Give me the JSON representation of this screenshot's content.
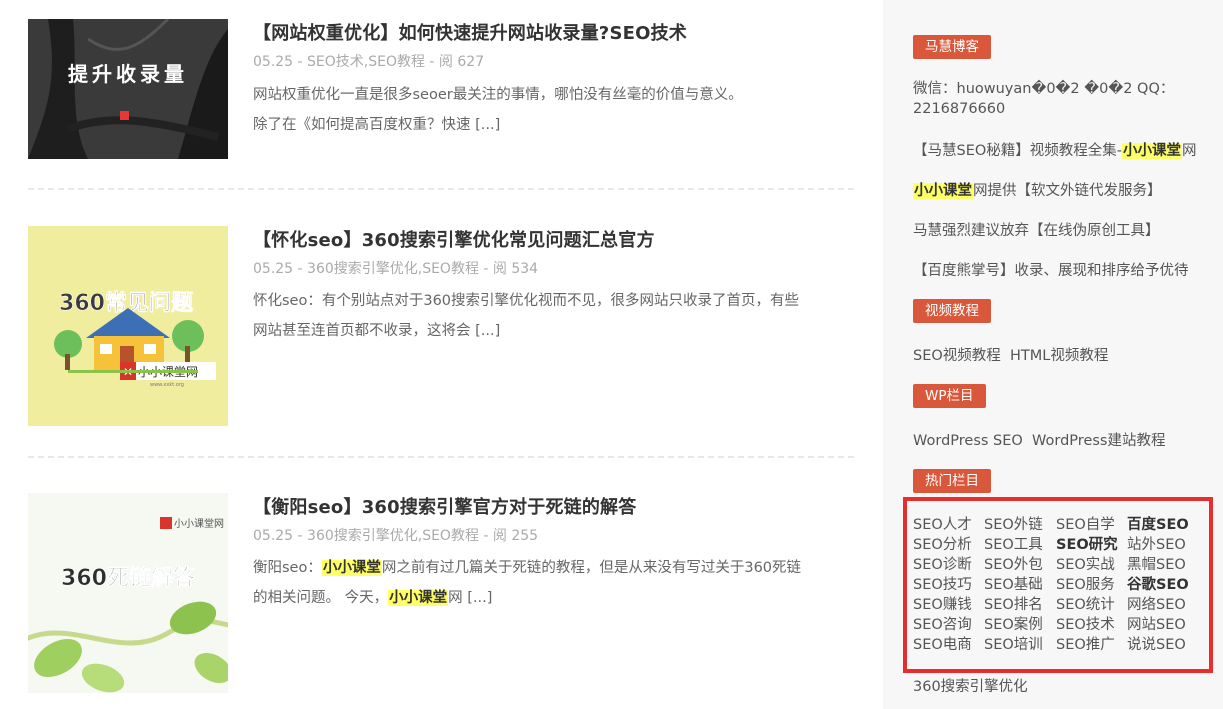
{
  "posts": [
    {
      "title": "【网站权重优化】如何快速提升网站收录量?SEO技术",
      "meta": "05.25 - SEO技术,SEO教程 - 阅 627",
      "excerpt_1": "网站权重优化一直是很多seoer最关注的事情，哪怕没有丝毫的价值与意义。",
      "excerpt_2": "除了在《如何提高百度权重？快速",
      "more": "[...]",
      "thumb_text": "提升收录量"
    },
    {
      "title": "【怀化seo】360搜索引擎优化常见问题汇总官方",
      "meta": "05.25 - 360搜索引擎优化,SEO教程 - 阅 534",
      "excerpt_1": "怀化seo：有个别站点对于360搜索引擎优化视而不见，很多网站只收录了首页，有些",
      "excerpt_2": "网站甚至连首页都不收录，这将会",
      "more": "[...]",
      "thumb_text": "360常见问题",
      "thumb_brand": "小小课堂网",
      "thumb_url": "www.xxkt.org"
    },
    {
      "title": "【衡阳seo】360搜索引擎官方对于死链的解答",
      "meta": "05.25 - 360搜索引擎优化,SEO教程 - 阅 255",
      "excerpt_1a": "衡阳seo：",
      "excerpt_1hl": "小小课堂",
      "excerpt_1b": "网之前有过几篇关于死链的教程，但是从来没有写过关于360死链",
      "excerpt_2a": "的相关问题。 今天，",
      "excerpt_2hl": "小小课堂",
      "excerpt_2b": "网",
      "more": "[...]",
      "thumb_text": "360死链解答",
      "thumb_brand": "小小课堂网"
    }
  ],
  "sidebar": {
    "blog_badge": "马慧博客",
    "contact": "微信：huowuyan�0�2 �0�2 QQ：2216876660",
    "link1_a": "【马慧SEO秘籍】视频教程全集-",
    "link1_hl": "小小课堂",
    "link1_b": "网",
    "link2_hl": "小小课堂",
    "link2_b": "网提供【软文外链代发服务】",
    "link3": "马慧强烈建议放弃【在线伪原创工具】",
    "link4": "【百度熊掌号】收录、展现和排序给予优待",
    "video_badge": "视频教程",
    "video_links": "SEO视频教程  HTML视频教程",
    "wp_badge": "WP栏目",
    "wp_links": "WordPress SEO  WordPress建站教程",
    "hot_badge": "热门栏目",
    "tags": [
      [
        "SEO人才",
        "SEO外链",
        "SEO自学",
        "百度SEO"
      ],
      [
        "SEO分析",
        "SEO工具",
        "SEO研究",
        "站外SEO"
      ],
      [
        "SEO诊断",
        "SEO外包",
        "SEO实战",
        "黑帽SEO"
      ],
      [
        "SEO技巧",
        "SEO基础",
        "SEO服务",
        "谷歌SEO"
      ],
      [
        "SEO赚钱",
        "SEO排名",
        "SEO统计",
        "网络SEO"
      ],
      [
        "SEO咨询",
        "SEO案例",
        "SEO技术",
        "网站SEO"
      ],
      [
        "SEO电商",
        "SEO培训",
        "SEO推广",
        "说说SEO"
      ]
    ],
    "bottom_link": "360搜索引擎优化"
  }
}
